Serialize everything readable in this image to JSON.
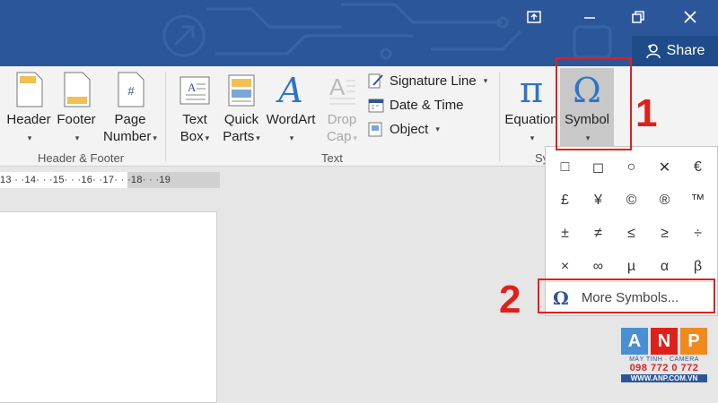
{
  "titlebar": {
    "share_label": "Share",
    "controls": [
      "restore-ribbon-icon",
      "minimize-icon",
      "restore-icon",
      "close-icon"
    ]
  },
  "ribbon": {
    "groups": {
      "header_footer": {
        "label": "Header & Footer",
        "buttons": [
          {
            "line1": "Header",
            "line2": ""
          },
          {
            "line1": "Footer",
            "line2": ""
          },
          {
            "line1": "Page",
            "line2": "Number"
          }
        ]
      },
      "text": {
        "label": "Text",
        "buttons": [
          {
            "line1": "Text",
            "line2": "Box"
          },
          {
            "line1": "Quick",
            "line2": "Parts"
          },
          {
            "line1": "WordArt",
            "line2": ""
          },
          {
            "line1": "Drop",
            "line2": "Cap"
          }
        ],
        "small": [
          "Signature Line",
          "Date & Time",
          "Object"
        ]
      },
      "symbols": {
        "label_partial": "Sy",
        "equation": "Equation",
        "symbol": "Symbol"
      }
    }
  },
  "ruler": {
    "text": "13 · ·14· · ·15· · ·16· ·17· · ·18· · ·19"
  },
  "symbol_menu": {
    "symbols": [
      "□",
      "◻",
      "○",
      "✕",
      "€",
      "£",
      "¥",
      "©",
      "®",
      "™",
      "±",
      "≠",
      "≤",
      "≥",
      "÷",
      "×",
      "∞",
      "µ",
      "α",
      "β"
    ],
    "more_symbols_icon": "Ω",
    "more_symbols_label": "More Symbols..."
  },
  "annotations": {
    "step1": "1",
    "step2": "2"
  },
  "watermark": {
    "letters": [
      "A",
      "N",
      "P"
    ],
    "tagline": "MÁY TÍNH · CAMERA",
    "phone": "098 772 0 772",
    "site": "WWW.ANP.COM.VN"
  },
  "colors": {
    "title_blue": "#2b579a",
    "annotation_red": "#e0201b",
    "anp_blue": "#4a8fd4",
    "anp_red": "#e0201b",
    "anp_orange": "#f08a1c"
  }
}
